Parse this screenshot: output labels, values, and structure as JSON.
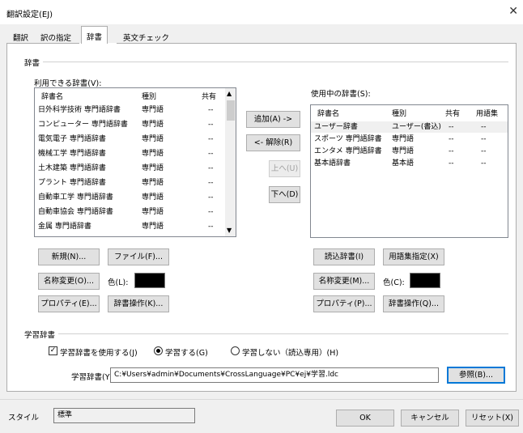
{
  "window": {
    "title": "翻訳設定(EJ)",
    "close": "✕"
  },
  "tabs": [
    {
      "label": "翻訳"
    },
    {
      "label": "訳の指定"
    },
    {
      "label": "辞書"
    },
    {
      "label": "英文チェック"
    }
  ],
  "dict_group": {
    "label": "辞書"
  },
  "available": {
    "label": "利用できる辞書(V):",
    "headers": [
      "辞書名",
      "種別",
      "共有"
    ],
    "rows": [
      [
        "日外科学技術 専門語辞書",
        "専門語",
        "--"
      ],
      [
        "コンピューター 専門語辞書",
        "専門語",
        "--"
      ],
      [
        "電気電子 専門語辞書",
        "専門語",
        "--"
      ],
      [
        "機械工学 専門語辞書",
        "専門語",
        "--"
      ],
      [
        "土木建築 専門語辞書",
        "専門語",
        "--"
      ],
      [
        "プラント 専門語辞書",
        "専門語",
        "--"
      ],
      [
        "自動車工学 専門語辞書",
        "専門語",
        "--"
      ],
      [
        "自動車協会 専門語辞書",
        "専門語",
        "--"
      ],
      [
        "金属 専門語辞書",
        "専門語",
        "--"
      ]
    ]
  },
  "in_use": {
    "label": "使用中の辞書(S):",
    "headers": [
      "辞書名",
      "種別",
      "共有",
      "用語集"
    ],
    "rows": [
      [
        "ユーザー辞書",
        "ユーザー(書込)",
        "--",
        "--"
      ],
      [
        "スポーツ 専門語辞書",
        "専門語",
        "--",
        "--"
      ],
      [
        "エンタメ 専門語辞書",
        "専門語",
        "--",
        "--"
      ],
      [
        "基本語辞書",
        "基本語",
        "--",
        "--"
      ]
    ]
  },
  "middle_buttons": {
    "add": "追加(A) ->",
    "remove": "<- 解除(R)",
    "up": "上へ(U)",
    "down": "下へ(D)"
  },
  "left_buttons": {
    "new": "新規(N)...",
    "file": "ファイル(F)...",
    "rename": "名称変更(O)...",
    "color_label": "色(L):",
    "props": "プロパティ(E)...",
    "ops": "辞書操作(K)..."
  },
  "right_buttons": {
    "readonly": "読込辞書(I)",
    "glossary": "用語集指定(X)",
    "rename": "名称変更(M)...",
    "color_label": "色(C):",
    "props": "プロパティ(P)...",
    "ops": "辞書操作(Q)..."
  },
  "learn_group": {
    "label": "学習辞書",
    "use_checkbox": "学習辞書を使用する(J)",
    "use_checked": true,
    "radio_learn": "学習する(G)",
    "radio_nolearn": "学習しない（読込専用）(H)",
    "selected": "learn",
    "path_label": "学習辞書(Y):",
    "path_value": "C:¥Users¥admin¥Documents¥CrossLanguage¥PC¥ej¥学習.ldc",
    "browse": "参照(B)..."
  },
  "footer": {
    "style_label": "スタイル",
    "style_value": "標準",
    "ok": "OK",
    "cancel": "キャンセル",
    "reset": "リセット(X)"
  },
  "colors": {
    "selected_color": "#000000",
    "focus_border": "#0078d7"
  }
}
